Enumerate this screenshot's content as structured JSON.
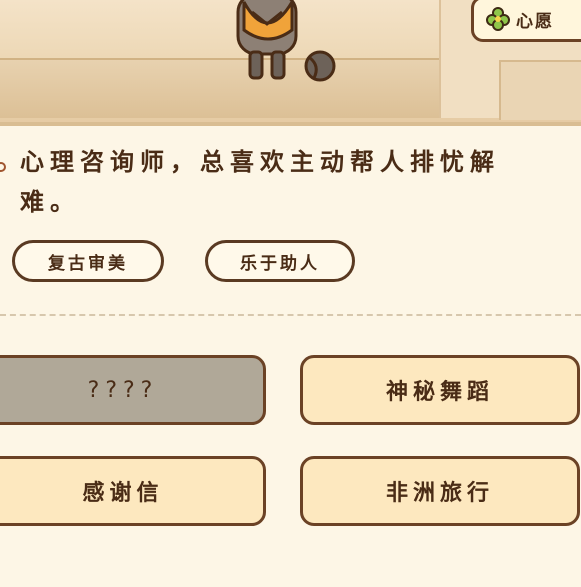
{
  "scene": {
    "wish_label": "心愿",
    "wish_icon": "clover-icon"
  },
  "profile": {
    "description_line1": "心理咨询师，总喜欢主动帮人排忧解",
    "description_line2": "难。",
    "tags": [
      "复古审美",
      "乐于助人"
    ]
  },
  "options": [
    {
      "label": "????",
      "locked": true
    },
    {
      "label": "神秘舞蹈",
      "locked": false
    },
    {
      "label": "感谢信",
      "locked": false
    },
    {
      "label": "非洲旅行",
      "locked": false
    }
  ],
  "colors": {
    "background": "#fdf6e6",
    "option_fill": "#fde8bf",
    "option_locked_fill": "#b0a898",
    "border": "#6b4225",
    "text": "#4a2c16"
  }
}
